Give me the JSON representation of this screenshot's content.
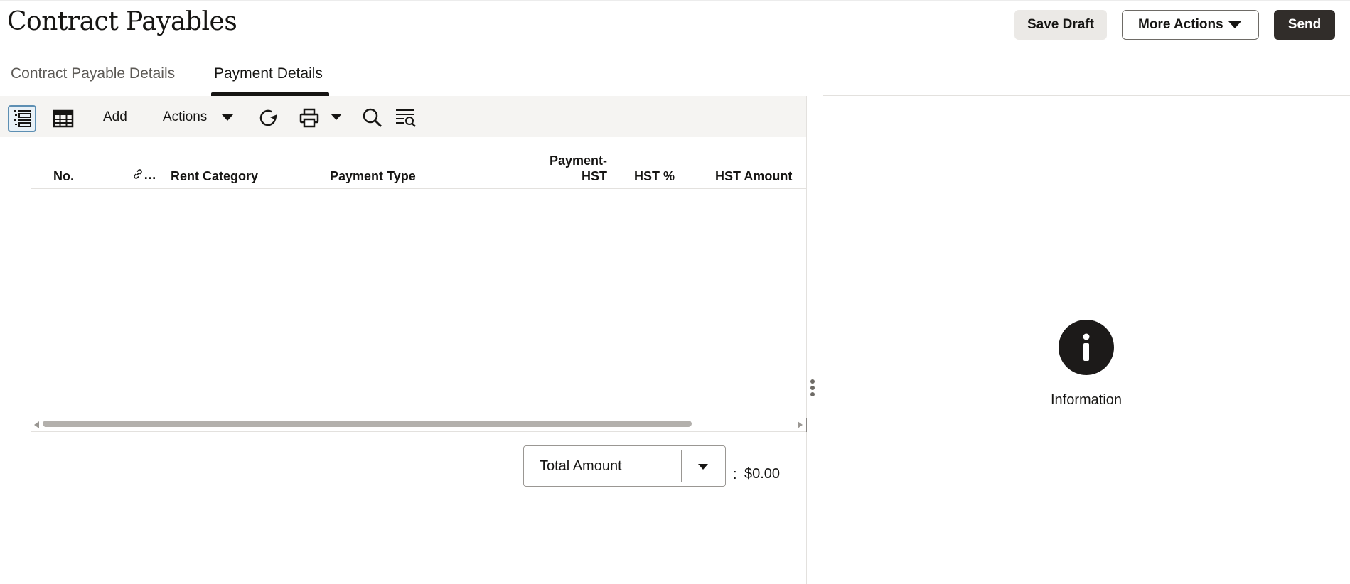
{
  "header": {
    "title": "Contract Payables",
    "save_draft": "Save Draft",
    "more_actions": "More Actions",
    "send": "Send"
  },
  "tabs": [
    {
      "label": "Contract Payable Details",
      "selected": false
    },
    {
      "label": "Payment Details",
      "selected": true
    }
  ],
  "toolbar": {
    "list_view_icon": "list-view-icon",
    "table_view_icon": "table-view-icon",
    "add": "Add",
    "actions": "Actions",
    "refresh_icon": "refresh-icon",
    "print_icon": "print-icon",
    "search_icon": "search-icon",
    "filter_icon": "query-by-example-icon"
  },
  "table": {
    "columns": [
      "No.",
      "…",
      "Rent Category",
      "Payment Type",
      "Payment-HST",
      "HST %",
      "HST Amount"
    ],
    "column_header_lines": {
      "payment_hst": [
        "Payment-",
        "HST"
      ]
    },
    "link_column_icon": "link-icon",
    "rows": []
  },
  "totals": {
    "selected": "Total Amount",
    "separator": ":",
    "value": "$0.00"
  },
  "info_panel": {
    "icon": "info-icon",
    "label": "Information"
  },
  "colors": {
    "send_bg": "#312d2a",
    "accent_selected": "#5d8fb3",
    "text": "#161513",
    "toolbar_bg": "#f5f4f2"
  }
}
